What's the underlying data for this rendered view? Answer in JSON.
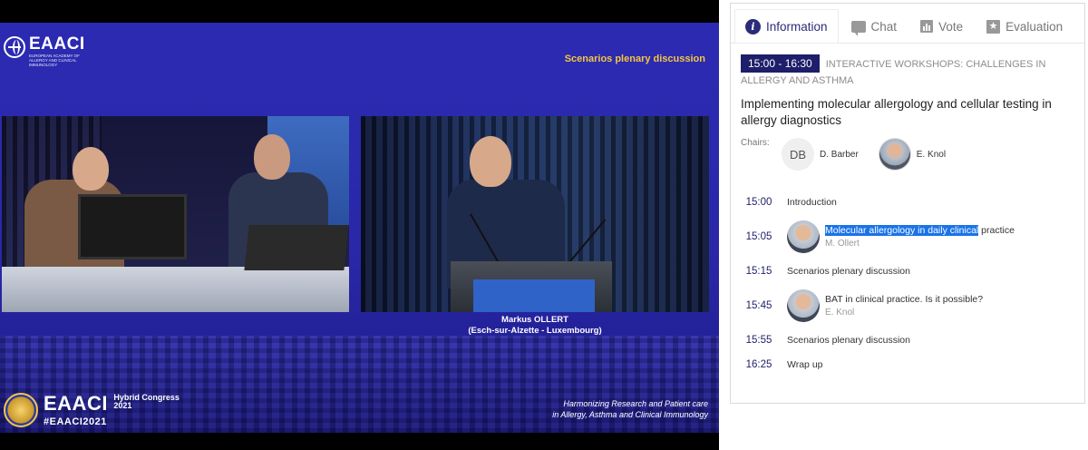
{
  "video": {
    "logo": {
      "name": "EAACI",
      "subtitle": "EUROPEAN ACADEMY OF ALLERGY AND CLINICAL IMMUNOLOGY"
    },
    "topic": "Scenarios plenary discussion",
    "speaker": {
      "name": "Markus OLLERT",
      "location": "(Esch-sur-Alzette - Luxembourg)"
    },
    "congress": {
      "brand": "EAACI",
      "title_line1": "Hybrid Congress",
      "year": "2021",
      "hashtag": "#EAACI2021"
    },
    "motto": {
      "line1": "Harmonizing Research and Patient care",
      "line2": "in Allergy, Asthma and Clinical Immunology"
    }
  },
  "panel": {
    "tabs": [
      {
        "label": "Information",
        "icon": "info-icon",
        "active": true
      },
      {
        "label": "Chat",
        "icon": "chat-icon",
        "active": false
      },
      {
        "label": "Vote",
        "icon": "vote-icon",
        "active": false
      },
      {
        "label": "Evaluation",
        "icon": "star-icon",
        "active": false
      }
    ],
    "session": {
      "time": "15:00 - 16:30",
      "category": "INTERACTIVE WORKSHOPS: CHALLENGES IN ALLERGY AND ASTHMA",
      "title": "Implementing molecular allergology and cellular testing in allergy diagnostics"
    },
    "chairs_label": "Chairs:",
    "chairs": [
      {
        "initials": "DB",
        "name": "D. Barber"
      },
      {
        "initials": "",
        "name": "E. Knol"
      }
    ],
    "agenda": [
      {
        "time": "15:00",
        "title": "Introduction",
        "speaker": ""
      },
      {
        "time": "15:05",
        "title_highlight": "Molecular allergology in daily clinical",
        "title_rest": " practice",
        "speaker": "M. Ollert"
      },
      {
        "time": "15:15",
        "title": "Scenarios plenary discussion",
        "speaker": ""
      },
      {
        "time": "15:45",
        "title": "BAT in clinical practice. Is it possible?",
        "speaker": "E. Knol"
      },
      {
        "time": "15:55",
        "title": "Scenarios plenary discussion",
        "speaker": ""
      },
      {
        "time": "16:25",
        "title": "Wrap up",
        "speaker": ""
      }
    ],
    "colors": {
      "accent": "#1e1e6a",
      "highlight": "#1a73e8"
    }
  }
}
